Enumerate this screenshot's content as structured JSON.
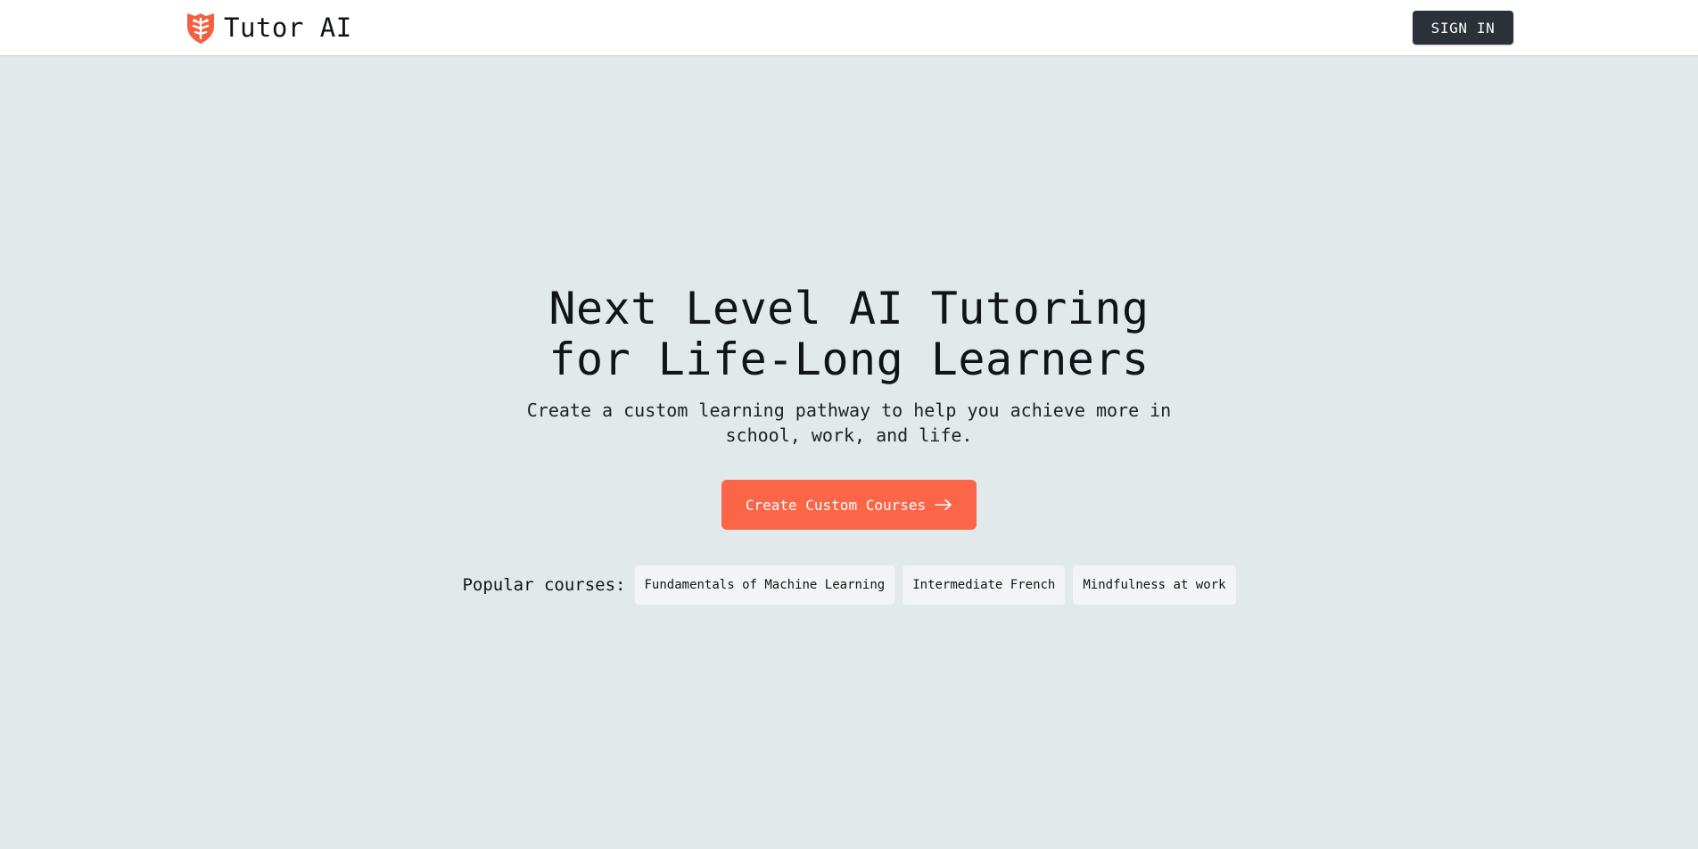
{
  "header": {
    "brand_name": "Tutor AI",
    "logo_icon": "shield-brain-icon",
    "sign_in_label": "SIGN IN"
  },
  "hero": {
    "title_line1": "Next Level AI Tutoring",
    "title_line2": "for Life-Long Learners",
    "subtitle": "Create a custom learning pathway to help you achieve more in school, work, and life.",
    "cta_label": "Create Custom Courses",
    "cta_icon": "arrow-right-icon"
  },
  "popular": {
    "label": "Popular courses:",
    "courses": [
      "Fundamentals of Machine Learning",
      "Intermediate French",
      "Mindfulness at work"
    ]
  },
  "colors": {
    "accent": "#fb6548",
    "background": "#e2e9eb",
    "header_bg": "#ffffff",
    "sign_in_bg": "#2c3038",
    "chip_bg": "#f2f4f6"
  }
}
